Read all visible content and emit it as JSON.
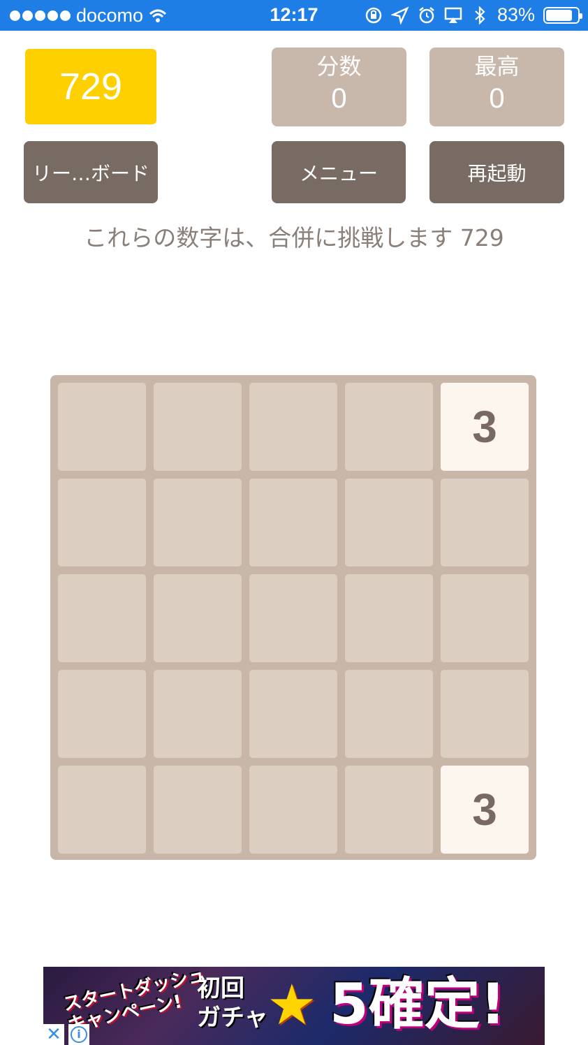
{
  "status_bar": {
    "carrier": "docomo",
    "time": "12:17",
    "battery": "83%",
    "battery_level": 0.83
  },
  "header": {
    "goal_value": "729",
    "score_label": "分数",
    "score_value": "0",
    "best_label": "最高",
    "best_value": "0"
  },
  "buttons": {
    "leaderboard": "リー…ボード",
    "menu": "メニュー",
    "restart": "再起動"
  },
  "subtitle": "これらの数字は、合併に挑戦します 729",
  "board": {
    "size": 5,
    "tiles": [
      {
        "row": 0,
        "col": 4,
        "value": "3"
      },
      {
        "row": 4,
        "col": 4,
        "value": "3"
      }
    ]
  },
  "ad": {
    "text_left_line1": "スタートダッシュ",
    "text_left_line2": "キャンペーン!",
    "text_mid_line1": "初回",
    "text_mid_line2": "ガチャ",
    "star": "★",
    "text_big": "5確定!",
    "close": "✕",
    "info": "i"
  },
  "colors": {
    "status_bar": "#1e7ee6",
    "goal_tile": "#ffd000",
    "stat_box": "#c8b8ac",
    "button": "#776b64",
    "board": "#c8b6a9",
    "cell": "#ddcec2",
    "tile": "#fdf6ef"
  }
}
